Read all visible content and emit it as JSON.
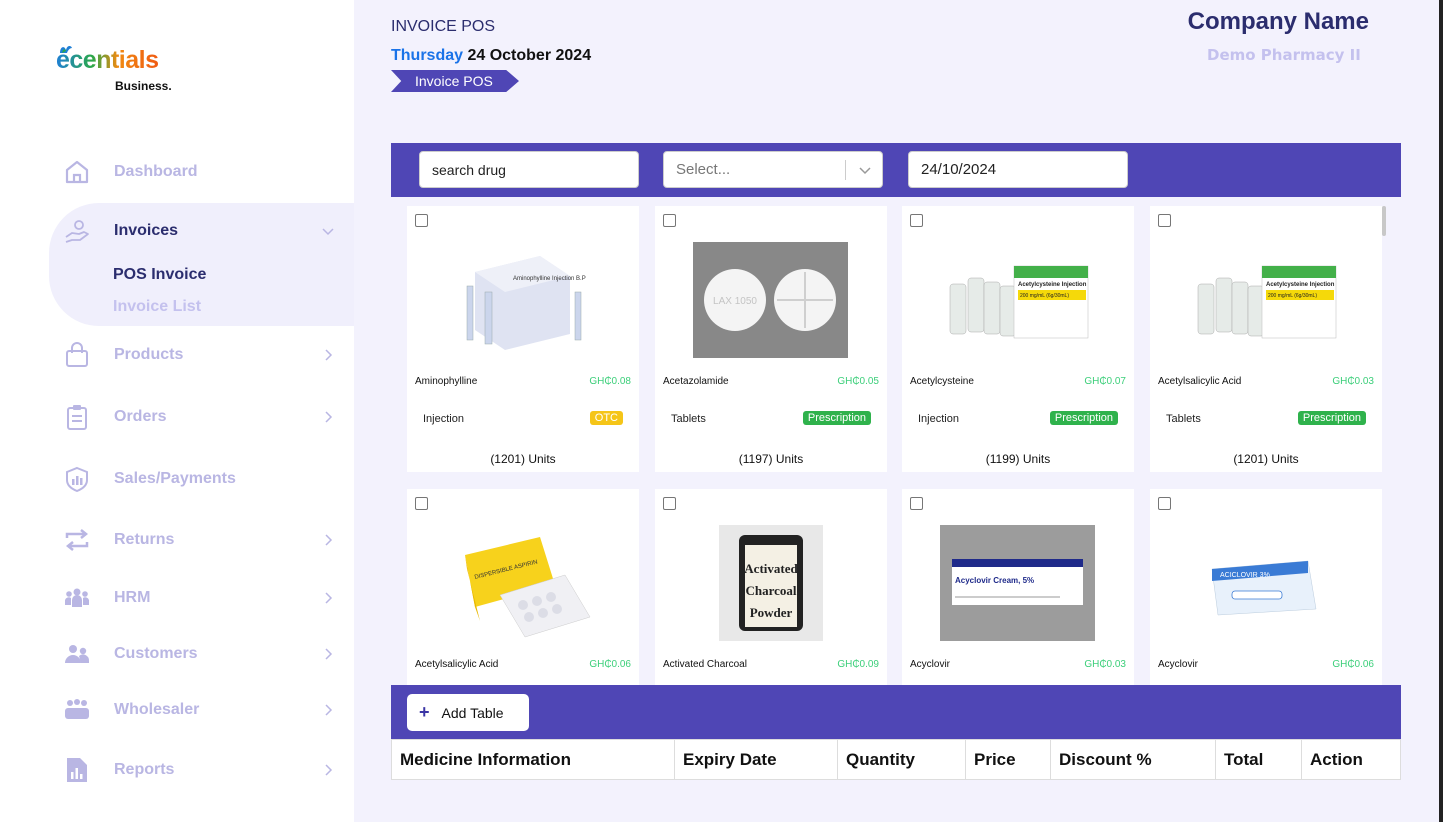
{
  "sidebar": {
    "logo_text": "ecentials",
    "logo_sub": "Business.",
    "items": [
      {
        "label": "Dashboard",
        "icon": "home-icon"
      },
      {
        "label": "Invoices",
        "icon": "hand-user-icon"
      },
      {
        "label": "Products",
        "icon": "bag-icon"
      },
      {
        "label": "Orders",
        "icon": "clipboard-icon"
      },
      {
        "label": "Sales/Payments",
        "icon": "shield-chart-icon"
      },
      {
        "label": "Returns",
        "icon": "swap-icon"
      },
      {
        "label": "HRM",
        "icon": "group-icon"
      },
      {
        "label": "Customers",
        "icon": "users-icon"
      },
      {
        "label": "Wholesaler",
        "icon": "team-icon"
      },
      {
        "label": "Reports",
        "icon": "report-icon"
      }
    ],
    "invoice_subitems": {
      "pos": "POS Invoice",
      "list": "Invoice List"
    }
  },
  "header": {
    "title": "INVOICE POS",
    "day": "Thursday",
    "date": "24 October 2024",
    "breadcrumb": "Invoice POS",
    "company": "Company Name",
    "company_sub": "Demo Pharmacy II"
  },
  "filters": {
    "search_placeholder": "search drug",
    "select_placeholder": "Select...",
    "date_value": "24/10/2024"
  },
  "products": [
    {
      "name": "Aminophylline",
      "price": "GH₵0.08",
      "form": "Injection",
      "badge": "OTC",
      "units": "(1201) Units"
    },
    {
      "name": "Acetazolamide",
      "price": "GH₵0.05",
      "form": "Tablets",
      "badge": "Prescription",
      "units": "(1197) Units"
    },
    {
      "name": "Acetylcysteine",
      "price": "GH₵0.07",
      "form": "Injection",
      "badge": "Prescription",
      "units": "(1199) Units"
    },
    {
      "name": "Acetylsalicylic Acid",
      "price": "GH₵0.03",
      "form": "Tablets",
      "badge": "Prescription",
      "units": "(1201) Units"
    },
    {
      "name": "Acetylsalicylic Acid",
      "price": "GH₵0.06",
      "form": "",
      "badge": "",
      "units": ""
    },
    {
      "name": "Activated Charcoal",
      "price": "GH₵0.09",
      "form": "",
      "badge": "",
      "units": ""
    },
    {
      "name": "Acyclovir",
      "price": "GH₵0.03",
      "form": "",
      "badge": "",
      "units": ""
    },
    {
      "name": "Acyclovir",
      "price": "GH₵0.06",
      "form": "",
      "badge": "",
      "units": ""
    }
  ],
  "image_text": {
    "aminophylline": "Aminophylline Injection B.P",
    "acetazolamide": "LAX 1050",
    "acetylcysteine": "Acetylcysteine Injection",
    "acetylcysteine_dose": "200 mg/mL (6g/30mL)",
    "aspirin": "DISPERSIBLE ASPIRIN",
    "charcoal": [
      "Activated",
      "Charcoal",
      "Powder"
    ],
    "acyclovir_cream": "Acyclovir Cream, 5%",
    "aciclovir": "ACICLOVIR 3%"
  },
  "bottom": {
    "add_button": "Add Table",
    "columns": [
      "Medicine Information",
      "Expiry Date",
      "Quantity",
      "Price",
      "Discount %",
      "Total",
      "Action"
    ]
  },
  "colors": {
    "accent": "#4f46b5",
    "otc": "#f5c518",
    "prescription": "#2fb24c",
    "price": "#3ccf7a"
  }
}
